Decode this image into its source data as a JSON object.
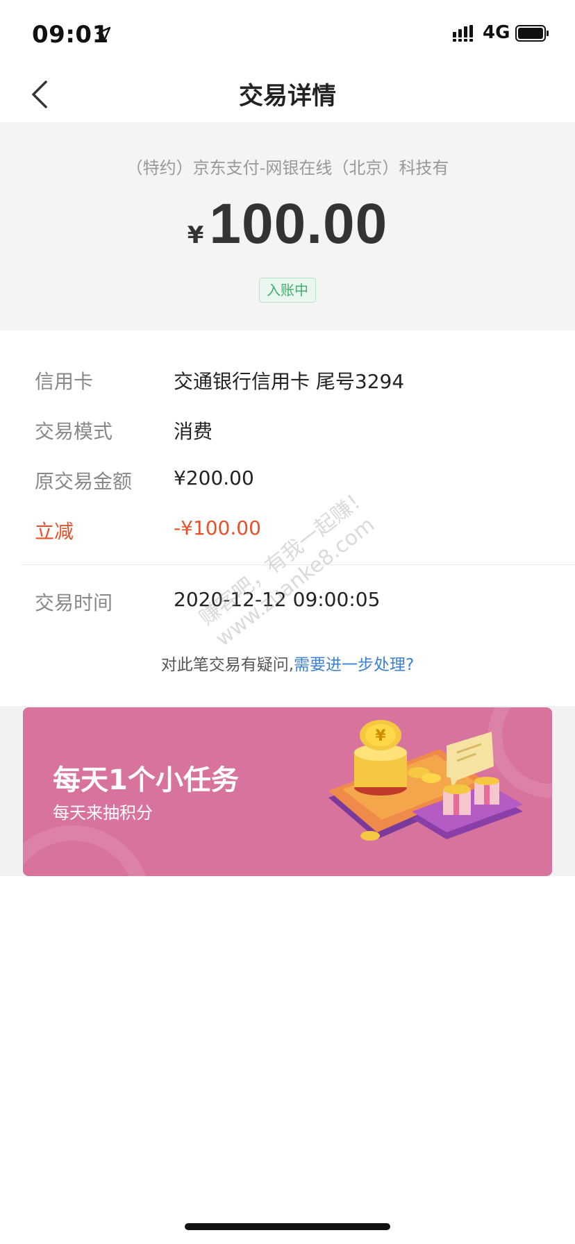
{
  "status_bar": {
    "time": "09:01",
    "network": "4G"
  },
  "nav": {
    "title": "交易详情"
  },
  "header": {
    "merchant": "（特约）京东支付-网银在线（北京）科技有",
    "currency": "¥",
    "amount": "100.00",
    "status": "入账中"
  },
  "details": [
    {
      "label": "信用卡",
      "value": "交通银行信用卡 尾号3294"
    },
    {
      "label": "交易模式",
      "value": "消费"
    },
    {
      "label": "原交易金额",
      "value": "¥200.00"
    },
    {
      "label": "立减",
      "value": "-¥100.00"
    }
  ],
  "time_row": {
    "label": "交易时间",
    "value": "2020-12-12 09:00:05"
  },
  "query": {
    "text": "对此笔交易有疑问,",
    "link": "需要进一步处理?"
  },
  "banner": {
    "title": "每天1个小任务",
    "subtitle": "每天来抽积分"
  },
  "watermark": {
    "line1": "赚客吧，有我一起赚！",
    "line2": "www.zuanke8.com"
  },
  "colors": {
    "discount": "#e8502a",
    "link": "#3d7fd1",
    "badge_green": "#3fae6c",
    "banner_bg": "#d8739e"
  }
}
